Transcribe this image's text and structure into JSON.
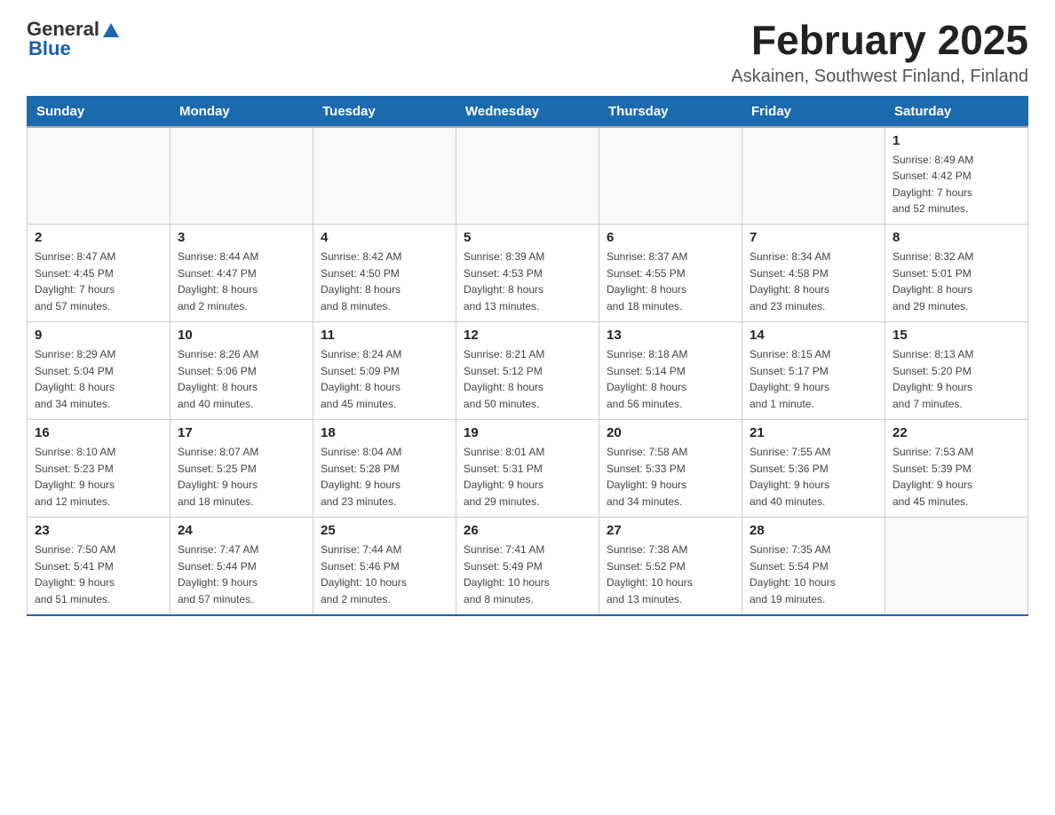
{
  "header": {
    "logo_general": "General",
    "logo_blue": "Blue",
    "month_title": "February 2025",
    "location": "Askainen, Southwest Finland, Finland"
  },
  "weekdays": [
    "Sunday",
    "Monday",
    "Tuesday",
    "Wednesday",
    "Thursday",
    "Friday",
    "Saturday"
  ],
  "weeks": [
    [
      {
        "day": "",
        "info": ""
      },
      {
        "day": "",
        "info": ""
      },
      {
        "day": "",
        "info": ""
      },
      {
        "day": "",
        "info": ""
      },
      {
        "day": "",
        "info": ""
      },
      {
        "day": "",
        "info": ""
      },
      {
        "day": "1",
        "info": "Sunrise: 8:49 AM\nSunset: 4:42 PM\nDaylight: 7 hours\nand 52 minutes."
      }
    ],
    [
      {
        "day": "2",
        "info": "Sunrise: 8:47 AM\nSunset: 4:45 PM\nDaylight: 7 hours\nand 57 minutes."
      },
      {
        "day": "3",
        "info": "Sunrise: 8:44 AM\nSunset: 4:47 PM\nDaylight: 8 hours\nand 2 minutes."
      },
      {
        "day": "4",
        "info": "Sunrise: 8:42 AM\nSunset: 4:50 PM\nDaylight: 8 hours\nand 8 minutes."
      },
      {
        "day": "5",
        "info": "Sunrise: 8:39 AM\nSunset: 4:53 PM\nDaylight: 8 hours\nand 13 minutes."
      },
      {
        "day": "6",
        "info": "Sunrise: 8:37 AM\nSunset: 4:55 PM\nDaylight: 8 hours\nand 18 minutes."
      },
      {
        "day": "7",
        "info": "Sunrise: 8:34 AM\nSunset: 4:58 PM\nDaylight: 8 hours\nand 23 minutes."
      },
      {
        "day": "8",
        "info": "Sunrise: 8:32 AM\nSunset: 5:01 PM\nDaylight: 8 hours\nand 29 minutes."
      }
    ],
    [
      {
        "day": "9",
        "info": "Sunrise: 8:29 AM\nSunset: 5:04 PM\nDaylight: 8 hours\nand 34 minutes."
      },
      {
        "day": "10",
        "info": "Sunrise: 8:26 AM\nSunset: 5:06 PM\nDaylight: 8 hours\nand 40 minutes."
      },
      {
        "day": "11",
        "info": "Sunrise: 8:24 AM\nSunset: 5:09 PM\nDaylight: 8 hours\nand 45 minutes."
      },
      {
        "day": "12",
        "info": "Sunrise: 8:21 AM\nSunset: 5:12 PM\nDaylight: 8 hours\nand 50 minutes."
      },
      {
        "day": "13",
        "info": "Sunrise: 8:18 AM\nSunset: 5:14 PM\nDaylight: 8 hours\nand 56 minutes."
      },
      {
        "day": "14",
        "info": "Sunrise: 8:15 AM\nSunset: 5:17 PM\nDaylight: 9 hours\nand 1 minute."
      },
      {
        "day": "15",
        "info": "Sunrise: 8:13 AM\nSunset: 5:20 PM\nDaylight: 9 hours\nand 7 minutes."
      }
    ],
    [
      {
        "day": "16",
        "info": "Sunrise: 8:10 AM\nSunset: 5:23 PM\nDaylight: 9 hours\nand 12 minutes."
      },
      {
        "day": "17",
        "info": "Sunrise: 8:07 AM\nSunset: 5:25 PM\nDaylight: 9 hours\nand 18 minutes."
      },
      {
        "day": "18",
        "info": "Sunrise: 8:04 AM\nSunset: 5:28 PM\nDaylight: 9 hours\nand 23 minutes."
      },
      {
        "day": "19",
        "info": "Sunrise: 8:01 AM\nSunset: 5:31 PM\nDaylight: 9 hours\nand 29 minutes."
      },
      {
        "day": "20",
        "info": "Sunrise: 7:58 AM\nSunset: 5:33 PM\nDaylight: 9 hours\nand 34 minutes."
      },
      {
        "day": "21",
        "info": "Sunrise: 7:55 AM\nSunset: 5:36 PM\nDaylight: 9 hours\nand 40 minutes."
      },
      {
        "day": "22",
        "info": "Sunrise: 7:53 AM\nSunset: 5:39 PM\nDaylight: 9 hours\nand 45 minutes."
      }
    ],
    [
      {
        "day": "23",
        "info": "Sunrise: 7:50 AM\nSunset: 5:41 PM\nDaylight: 9 hours\nand 51 minutes."
      },
      {
        "day": "24",
        "info": "Sunrise: 7:47 AM\nSunset: 5:44 PM\nDaylight: 9 hours\nand 57 minutes."
      },
      {
        "day": "25",
        "info": "Sunrise: 7:44 AM\nSunset: 5:46 PM\nDaylight: 10 hours\nand 2 minutes."
      },
      {
        "day": "26",
        "info": "Sunrise: 7:41 AM\nSunset: 5:49 PM\nDaylight: 10 hours\nand 8 minutes."
      },
      {
        "day": "27",
        "info": "Sunrise: 7:38 AM\nSunset: 5:52 PM\nDaylight: 10 hours\nand 13 minutes."
      },
      {
        "day": "28",
        "info": "Sunrise: 7:35 AM\nSunset: 5:54 PM\nDaylight: 10 hours\nand 19 minutes."
      },
      {
        "day": "",
        "info": ""
      }
    ]
  ]
}
